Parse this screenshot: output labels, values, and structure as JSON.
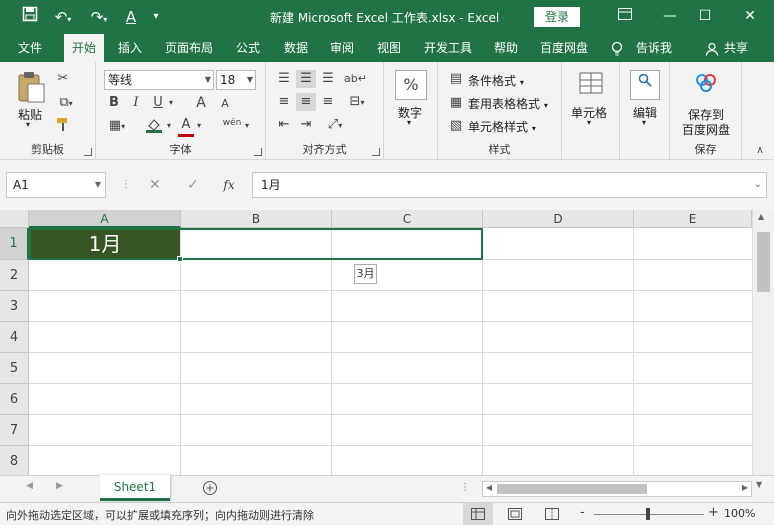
{
  "titlebar": {
    "title": "新建 Microsoft Excel 工作表.xlsx  -  Excel",
    "login_label": "登录",
    "qa_icons": [
      "save-icon",
      "undo-icon",
      "redo-icon",
      "font-color-icon",
      "customize-icon"
    ],
    "accent": "#217346"
  },
  "menu": {
    "tabs": [
      "文件",
      "开始",
      "插入",
      "页面布局",
      "公式",
      "数据",
      "审阅",
      "视图",
      "开发工具",
      "帮助",
      "百度网盘"
    ],
    "active": "开始",
    "tell_me": "告诉我",
    "share": "共享"
  },
  "ribbon": {
    "clipboard": {
      "label": "剪贴板",
      "paste": "粘贴"
    },
    "font": {
      "label": "字体",
      "font_name": "等线",
      "font_size": "18",
      "bold": "B",
      "italic": "I",
      "underline": "U",
      "grow": "A",
      "shrink": "A",
      "font_color": "A",
      "phonetic": "wén"
    },
    "alignment": {
      "label": "对齐方式"
    },
    "number": {
      "label": "数字",
      "percent": "%"
    },
    "styles": {
      "label": "样式",
      "conditional": "条件格式",
      "table_format": "套用表格格式",
      "cell_styles": "单元格样式"
    },
    "cells": {
      "label": "单元格"
    },
    "editing": {
      "label": "编辑"
    },
    "save": {
      "label": "保存",
      "save_to": "保存到",
      "baidu": "百度网盘"
    }
  },
  "formula_bar": {
    "name_box": "A1",
    "fx": "fx",
    "value": "1月"
  },
  "grid": {
    "columns": [
      "A",
      "B",
      "C",
      "D",
      "E"
    ],
    "rows": [
      "1",
      "2",
      "3",
      "4",
      "5",
      "6",
      "7",
      "8"
    ],
    "a1_value": "1月",
    "fill_tooltip": "3月",
    "selected_fill": "#375623"
  },
  "sheets": {
    "tabs": [
      "Sheet1"
    ],
    "add_icon": "plus-circle-icon"
  },
  "status": {
    "message": "向外拖动选定区域，可以扩展或填充序列；向内拖动则进行清除",
    "zoom": "100%",
    "zoom_minus": "-",
    "zoom_plus": "+"
  }
}
